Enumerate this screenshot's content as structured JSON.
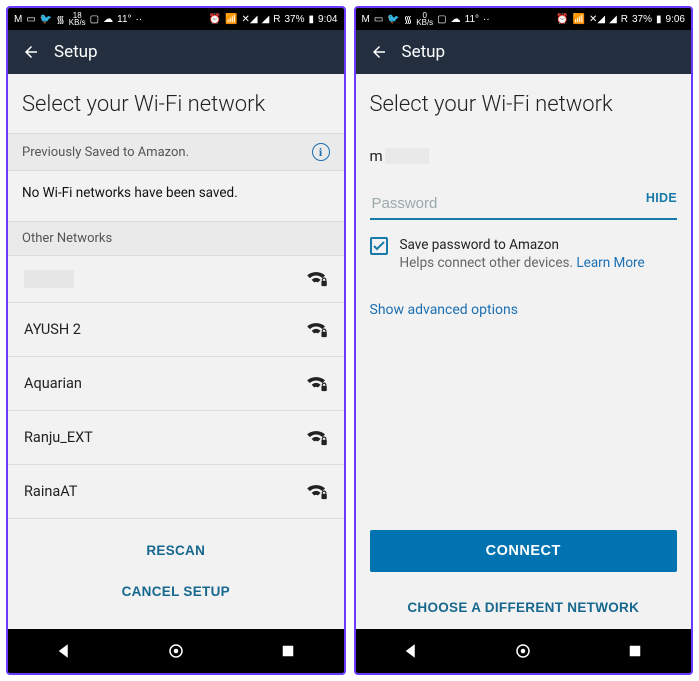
{
  "left": {
    "status": {
      "kbs": "18",
      "kbs_unit": "KB/s",
      "temp": "11°",
      "net": "R",
      "batt": "37%",
      "time": "9:04"
    },
    "appbar": {
      "title": "Setup"
    },
    "page_title": "Select your Wi-Fi network",
    "section_saved": "Previously Saved to Amazon.",
    "empty_saved": "No Wi-Fi networks have been saved.",
    "section_other": "Other Networks",
    "networks": [
      {
        "name": ""
      },
      {
        "name": "AYUSH 2"
      },
      {
        "name": "Aquarian"
      },
      {
        "name": "Ranju_EXT"
      },
      {
        "name": "RainaAT"
      }
    ],
    "rescan": "RESCAN",
    "cancel": "CANCEL SETUP"
  },
  "right": {
    "status": {
      "kbs": "0",
      "kbs_unit": "KB/s",
      "temp": "11°",
      "net": "R",
      "batt": "37%",
      "time": "9:06"
    },
    "appbar": {
      "title": "Setup"
    },
    "page_title": "Select your Wi-Fi network",
    "ssid_prefix": "m",
    "pw_placeholder": "Password",
    "hide": "HIDE",
    "save_label": "Save password to Amazon",
    "save_help": "Helps connect other devices. ",
    "learn_more": "Learn More",
    "advanced": "Show advanced options",
    "connect": "CONNECT",
    "choose": "CHOOSE A DIFFERENT NETWORK"
  }
}
